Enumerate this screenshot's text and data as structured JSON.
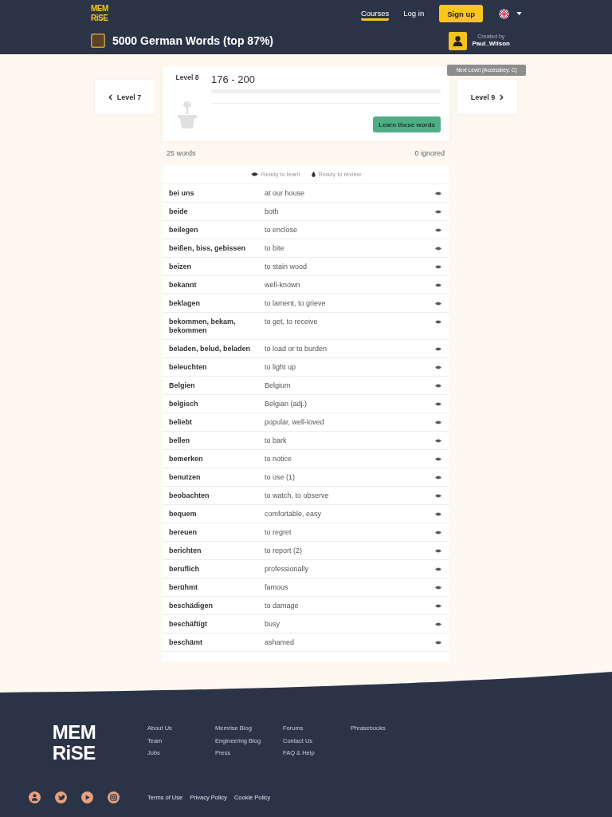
{
  "header": {
    "logo": [
      "MEM",
      "RiSE"
    ],
    "nav": [
      {
        "label": "Courses",
        "selected": true
      },
      {
        "label": "Log in",
        "selected": false
      }
    ],
    "signup_button": "Sign up"
  },
  "course": {
    "title": "5000 German Words (top 87%)",
    "created_by_label": "Created by",
    "author": "Paul_Wilson"
  },
  "level_nav": {
    "previous": "Level 7",
    "next": "Level 9",
    "next_tooltip": "Next Level (Accesskey: C)"
  },
  "level": {
    "label": "Level 8",
    "range": "176 - 200",
    "button": "Learn these words"
  },
  "summary": {
    "word_count": "25 words",
    "ignored": "0 ignored"
  },
  "legend": [
    {
      "kind": "learn",
      "label": "Ready to learn"
    },
    {
      "kind": "review",
      "label": "Ready to review"
    }
  ],
  "words": [
    {
      "word": "bei uns",
      "meaning": "at our house",
      "kind": "learn"
    },
    {
      "word": "beide",
      "meaning": "both",
      "kind": "learn"
    },
    {
      "word": "beilegen",
      "meaning": "to enclose",
      "kind": "learn"
    },
    {
      "word": "beißen, biss, gebissen",
      "meaning": "to bite",
      "kind": "learn"
    },
    {
      "word": "beizen",
      "meaning": "to stain wood",
      "kind": "learn"
    },
    {
      "word": "bekannt",
      "meaning": "well-known",
      "kind": "learn"
    },
    {
      "word": "beklagen",
      "meaning": "to lament, to grieve",
      "kind": "learn"
    },
    {
      "word": "bekommen, bekam, bekommen",
      "meaning": "to get, to receive",
      "kind": "learn"
    },
    {
      "word": "beladen, belud, beladen",
      "meaning": "to load or to burden",
      "kind": "learn"
    },
    {
      "word": "beleuchten",
      "meaning": "to light up",
      "kind": "learn"
    },
    {
      "word": "Belgien",
      "meaning": "Belgium",
      "kind": "learn"
    },
    {
      "word": "belgisch",
      "meaning": "Belgian (adj.)",
      "kind": "learn"
    },
    {
      "word": "beliebt",
      "meaning": "popular, well-loved",
      "kind": "learn"
    },
    {
      "word": "bellen",
      "meaning": "to bark",
      "kind": "learn"
    },
    {
      "word": "bemerken",
      "meaning": "to notice",
      "kind": "learn"
    },
    {
      "word": "benutzen",
      "meaning": "to use (1)",
      "kind": "learn"
    },
    {
      "word": "beobachten",
      "meaning": "to watch, to observe",
      "kind": "learn"
    },
    {
      "word": "bequem",
      "meaning": "comfortable, easy",
      "kind": "learn"
    },
    {
      "word": "bereuen",
      "meaning": "to regret",
      "kind": "learn"
    },
    {
      "word": "berichten",
      "meaning": "to report (2)",
      "kind": "learn"
    },
    {
      "word": "beruflich",
      "meaning": "professionally",
      "kind": "learn"
    },
    {
      "word": "berühmt",
      "meaning": "famous",
      "kind": "learn"
    },
    {
      "word": "beschädigen",
      "meaning": "to damage",
      "kind": "learn"
    },
    {
      "word": "beschäftigt",
      "meaning": "busy",
      "kind": "learn"
    },
    {
      "word": "beschämt",
      "meaning": "ashamed",
      "kind": "learn"
    }
  ],
  "footer": {
    "logo": [
      "MEM",
      "RiSE"
    ],
    "link_columns": [
      [
        "About Us",
        "Team",
        "Jobs"
      ],
      [
        "Memrise Blog",
        "Engineering Blog",
        "Press"
      ],
      [
        "Forums",
        "Contact Us",
        "FAQ & Help"
      ],
      [
        "Phrasebooks"
      ]
    ],
    "legal_links": [
      "Terms of Use",
      "Privacy Policy",
      "Cookie Policy"
    ]
  }
}
